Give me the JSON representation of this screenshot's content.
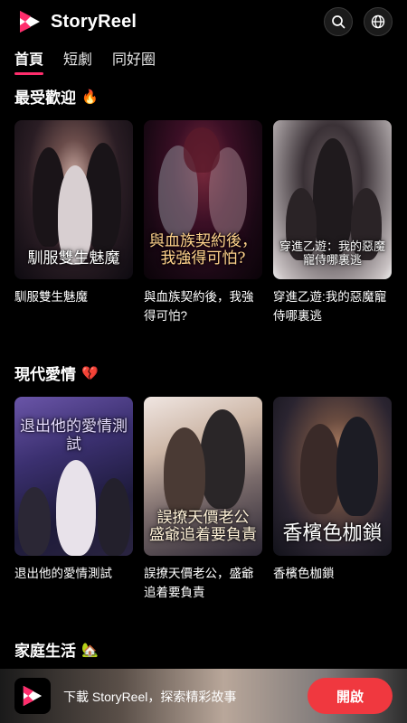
{
  "app": {
    "name": "StoryReel"
  },
  "header": {
    "search_icon": "search-icon",
    "language_icon": "globe-icon"
  },
  "tabs": [
    {
      "label": "首頁",
      "active": true
    },
    {
      "label": "短劇",
      "active": false
    },
    {
      "label": "同好圈",
      "active": false
    }
  ],
  "sections": [
    {
      "title": "最受歡迎",
      "emoji": "🔥",
      "items": [
        {
          "title": "馴服雙生魅魔",
          "poster_text": "馴服雙生魅魔"
        },
        {
          "title": "與血族契約後，我強得可怕?",
          "poster_text": "與血族契約後，我強得可怕?"
        },
        {
          "title": "穿進乙遊:我的惡魔寵侍哪裏逃",
          "poster_text": "穿進乙遊：我的惡魔寵侍哪裏逃"
        }
      ]
    },
    {
      "title": "現代愛情",
      "emoji": "💔",
      "items": [
        {
          "title": "退出他的愛情測試",
          "poster_text": "退出他的愛情測試"
        },
        {
          "title": "誤撩天價老公，盛爺追着要負責",
          "poster_text": "誤撩天價老公 盛爺追着要負責"
        },
        {
          "title": "香檳色枷鎖",
          "poster_text": "香檳色枷鎖"
        }
      ]
    },
    {
      "title": "家庭生活",
      "emoji": "🏡"
    }
  ],
  "banner": {
    "text": "下載 StoryReel，探索精彩故事",
    "button_label": "開啟"
  },
  "colors": {
    "accent": "#ff2d6c",
    "button": "#f0383f",
    "background": "#000000"
  }
}
